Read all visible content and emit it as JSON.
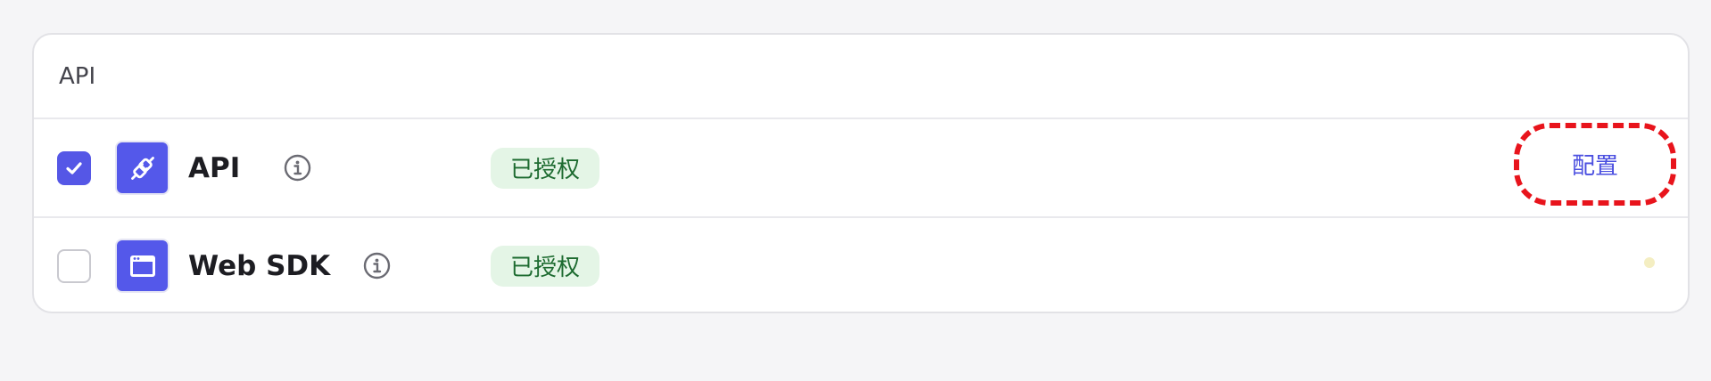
{
  "section": {
    "title": "API"
  },
  "rows": [
    {
      "name": "API",
      "checked": true,
      "icon": "plug-icon",
      "status": "已授权",
      "action": "配置"
    },
    {
      "name": "Web SDK",
      "checked": false,
      "icon": "browser-window-icon",
      "status": "已授权"
    }
  ],
  "colors": {
    "accent": "#5458ea",
    "badge_bg": "#e4f5e6",
    "badge_text": "#1d6b30",
    "highlight": "#e8141c"
  }
}
